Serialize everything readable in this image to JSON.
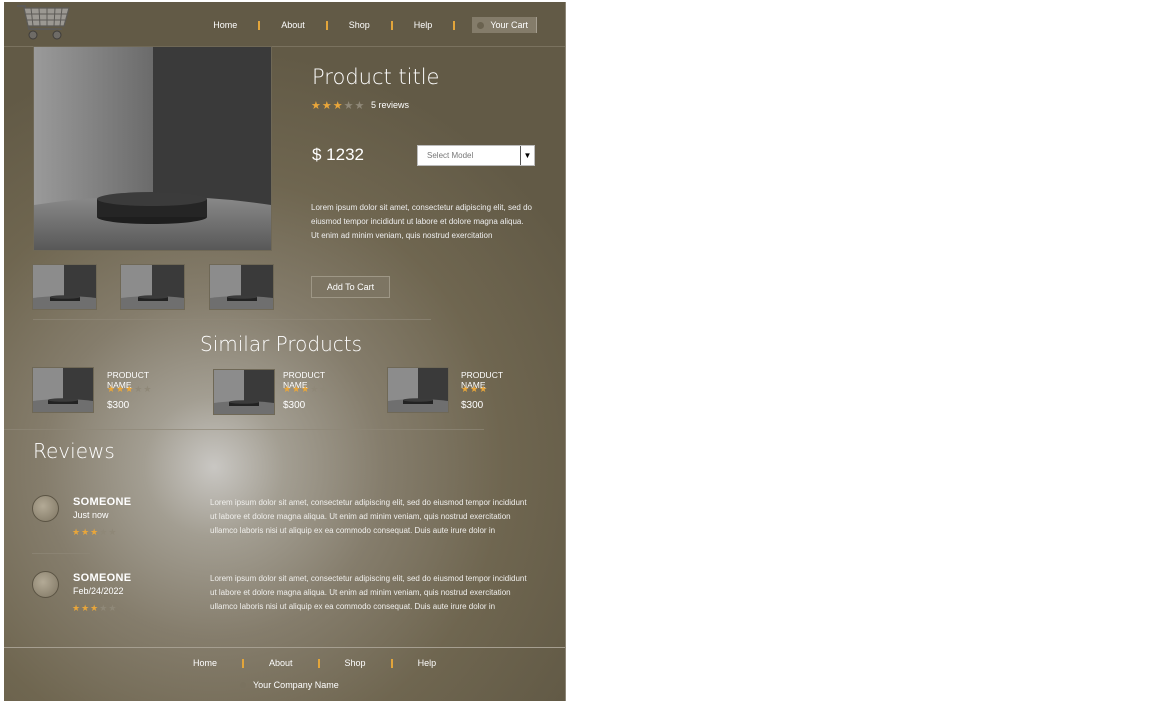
{
  "header": {
    "nav": [
      "Home",
      "About",
      "Shop",
      "Help"
    ],
    "cart_label": "Your Cart"
  },
  "product": {
    "title": "Product title",
    "rating": 3,
    "rating_max": 5,
    "reviews_count": "5 reviews",
    "price": "$ 1232",
    "model_select": {
      "value": "Select Model"
    },
    "description": "Lorem ipsum dolor sit amet, consectetur adipiscing elit, sed do eiusmod tempor incididunt ut labore et dolore magna aliqua. Ut enim ad minim veniam, quis nostrud exercitation",
    "add_to_cart": "Add To Cart",
    "thumbnails": 3
  },
  "similar": {
    "title": "Similar Products",
    "items": [
      {
        "name": "PRODUCT NAME",
        "price": "$300",
        "rating": 3
      },
      {
        "name": "PRODUCT NAME",
        "price": "$300",
        "rating": 3
      },
      {
        "name": "PRODUCT NAME",
        "price": "$300",
        "rating": 3
      }
    ]
  },
  "reviews": {
    "title": "Reviews",
    "items": [
      {
        "name": "SOMEONE",
        "time": "Just now",
        "rating": 3,
        "text": "Lorem ipsum dolor sit amet, consectetur adipiscing elit, sed do eiusmod tempor incididunt ut labore et dolore magna aliqua. Ut enim ad minim veniam, quis nostrud exercitation ullamco laboris nisi ut aliquip ex ea commodo consequat. Duis aute irure dolor in"
      },
      {
        "name": "SOMEONE",
        "time": "Feb/24/2022",
        "rating": 3,
        "text": "Lorem ipsum dolor sit amet, consectetur adipiscing elit, sed do eiusmod tempor incididunt ut labore et dolore magna aliqua. Ut enim ad minim veniam, quis nostrud exercitation ullamco laboris nisi ut aliquip ex ea commodo consequat. Duis aute irure dolor in"
      }
    ]
  },
  "footer": {
    "nav": [
      "Home",
      "About",
      "Shop",
      "Help"
    ],
    "company": "Your Company Name"
  },
  "colors": {
    "accent": "#e9a63a",
    "panel": "#6f6650",
    "button": "#847c6a"
  },
  "icons": {
    "logo": "shopping-cart-icon",
    "select_arrow": "dropdown-arrow-icon",
    "star": "star-icon"
  }
}
